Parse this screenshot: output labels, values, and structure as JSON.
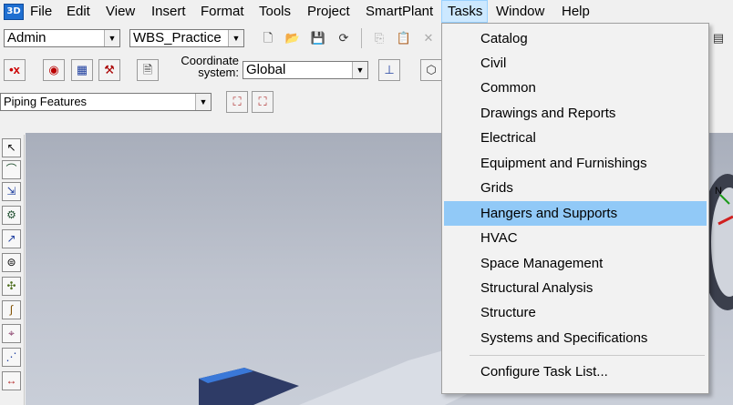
{
  "app": {
    "icon_text": "3D"
  },
  "menubar": {
    "items": [
      "File",
      "Edit",
      "View",
      "Insert",
      "Format",
      "Tools",
      "Project",
      "SmartPlant",
      "Tasks",
      "Window",
      "Help"
    ],
    "active": "Tasks"
  },
  "toolbar": {
    "user_combo": "Admin",
    "wbs_combo": "WBS_Practice",
    "coordinate_label_line1": "Coordinate",
    "coordinate_label_line2": "system:",
    "coordinate_combo": "Global",
    "features_combo": "Piping Features"
  },
  "tasks_menu": {
    "items": [
      "Catalog",
      "Civil",
      "Common",
      "Drawings and Reports",
      "Electrical",
      "Equipment and Furnishings",
      "Grids",
      "Hangers and Supports",
      "HVAC",
      "Space Management",
      "Structural Analysis",
      "Structure",
      "Systems and Specifications"
    ],
    "highlighted": "Hangers and Supports",
    "footer_item": "Configure Task List..."
  },
  "viewport": {
    "compass_label": "N"
  },
  "colors": {
    "highlight": "#91c9f7",
    "viewport_bg": "#b8bdc8",
    "object_top": "#3a78d8",
    "object_side": "#2e3b66"
  }
}
